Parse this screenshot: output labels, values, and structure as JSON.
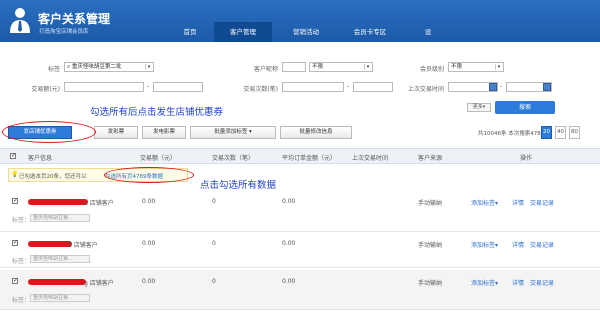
{
  "app": {
    "title": "客户关系管理",
    "subtitle": "打造淘宝店铺会员库"
  },
  "nav": [
    "首页",
    "客户管理",
    "营销活动",
    "会员卡专区",
    "设"
  ],
  "filters": {
    "tag_label": "标签",
    "tag_value": "重庆怪味胡豆第二批",
    "nickname_label": "客户昵称",
    "nickname_value": "",
    "region_value": "不限",
    "level_label": "会员级别",
    "level_value": "不限",
    "amount_label": "交易额(元)",
    "count_label": "交易次数(笔)",
    "last_time_label": "上次交易时间",
    "more_label": "更多",
    "search_label": "搜索"
  },
  "toolbar": {
    "send_coupon": "发店铺优惠券",
    "send_lottery": "发彩票",
    "send_movie": "发电影票",
    "batch_tag": "批量添加标签",
    "batch_edit": "批量修改信息",
    "summary": "共10046条 本次搜索4789条",
    "page_sizes": [
      "20",
      "40",
      "80"
    ]
  },
  "table": {
    "headers": [
      "客户信息",
      "交易额（元）",
      "交易次数（笔）",
      "平均订单金额（元）",
      "上次交易时间",
      "客户来源",
      "操作"
    ],
    "notice_text": "已勾选本页20条，您还可以",
    "notice_link": "勾选所有页4789条数据",
    "rows": [
      {
        "name_suffix": "n 店铺客户",
        "amount": "0.00",
        "count": "0",
        "avg": "0.00",
        "source": "手动输纳"
      },
      {
        "name_suffix": "8 店铺客户",
        "amount": "0.00",
        "count": "0",
        "avg": "0.00",
        "source": "手动输纳"
      },
      {
        "name_suffix": "g 店铺客户",
        "amount": "0.00",
        "count": "0",
        "avg": "0.00",
        "source": "手动输纳"
      }
    ],
    "tag_label": "标签：",
    "tag_value": "重庆怪味胡豆第...",
    "action_tag": "添加标签",
    "action_detail": "详情",
    "action_record": "交易记录"
  },
  "annotations": {
    "coupon": "勾选所有后点击发生店铺优惠券",
    "select_all": "点击勾选所有数据"
  },
  "colors": {
    "header_blue": "#1d5aa8",
    "accent": "#2c7bd8",
    "annotation": "#1f3fd0",
    "highlight": "#d8161b"
  }
}
